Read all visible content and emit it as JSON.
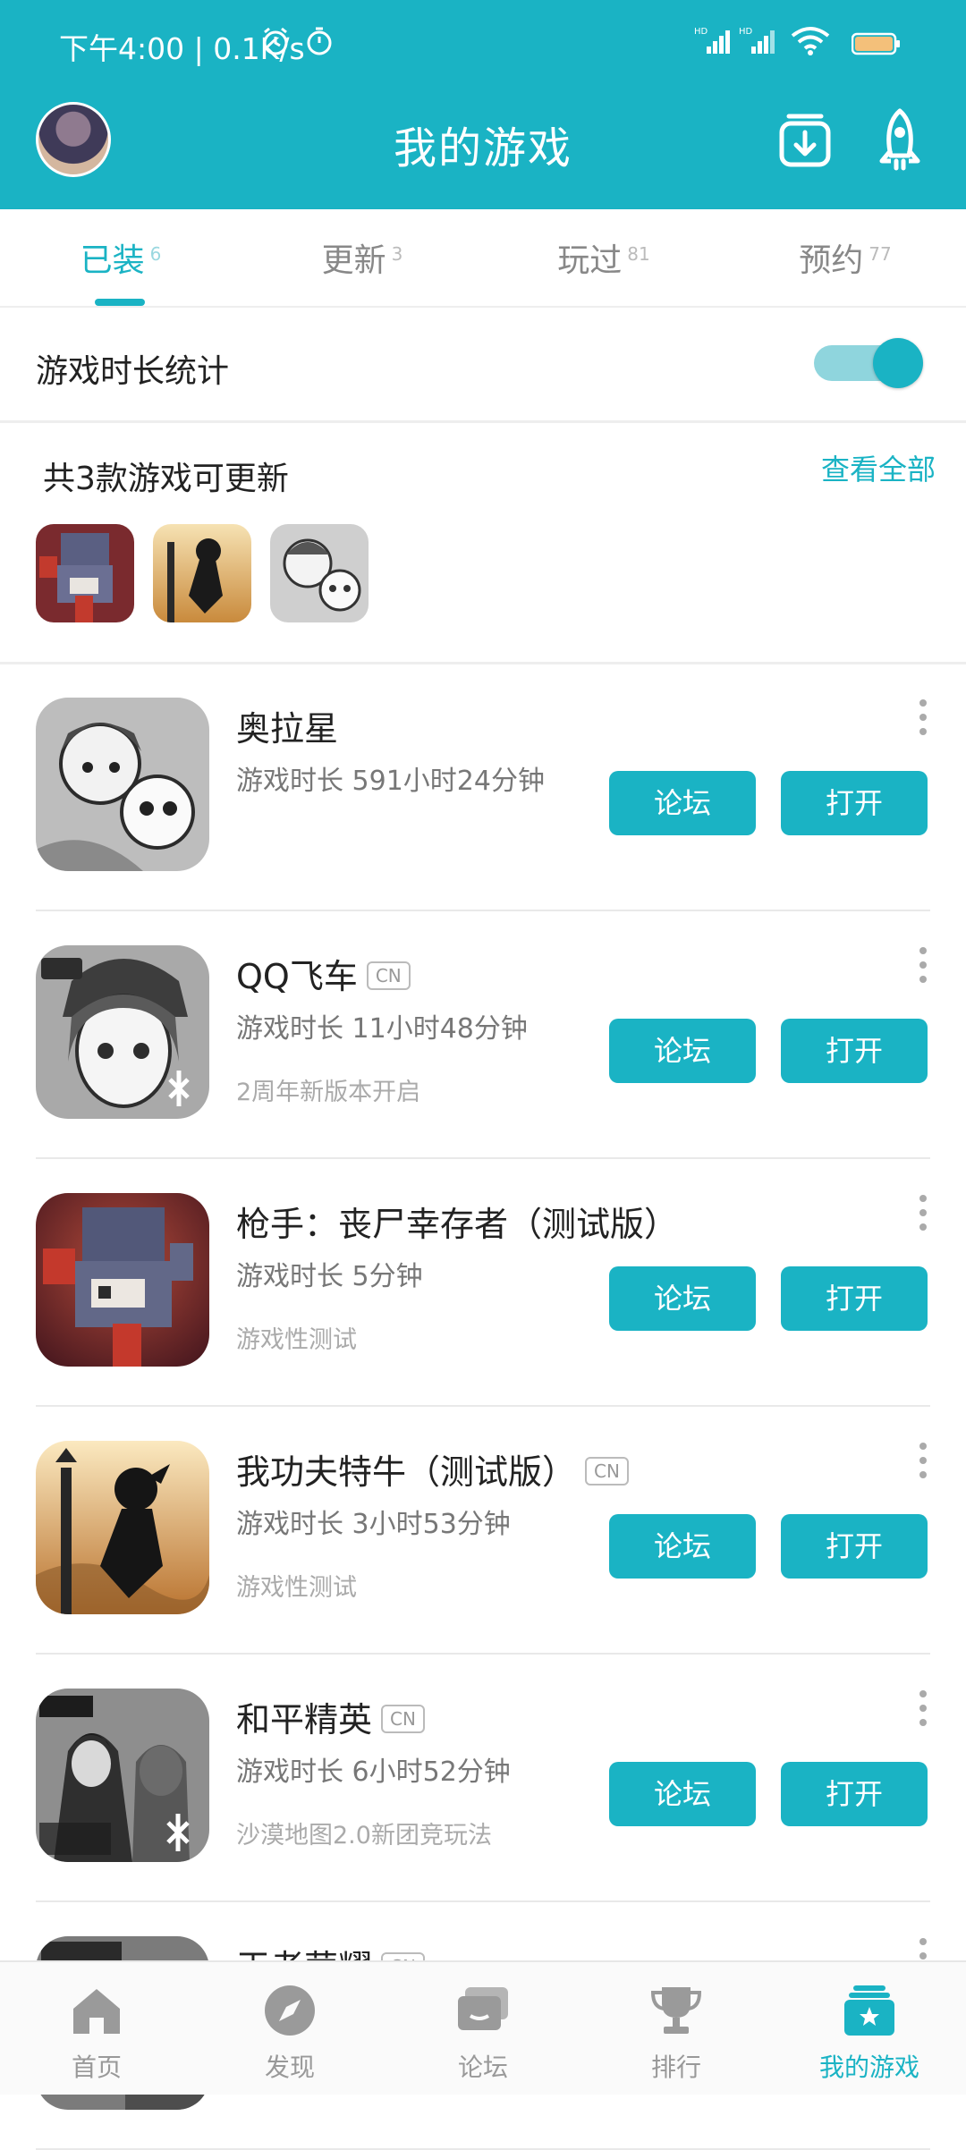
{
  "status_bar": {
    "time": "下午4:00 | 0.1K/s",
    "icons": [
      "alarm-icon",
      "timer-icon",
      "hd-signal-icon",
      "hd-signal-icon",
      "wifi-icon",
      "battery-icon"
    ]
  },
  "header": {
    "title": "我的游戏",
    "icons": [
      "avatar",
      "download-manager-icon",
      "rocket-icon"
    ]
  },
  "tabs": [
    {
      "label": "已装",
      "count": "6"
    },
    {
      "label": "更新",
      "count": "3"
    },
    {
      "label": "玩过",
      "count": "81"
    },
    {
      "label": "预约",
      "count": "77"
    }
  ],
  "active_tab": "已装",
  "stats": {
    "label": "游戏时长统计",
    "toggle_on": true
  },
  "updates": {
    "title": "共3款游戏可更新",
    "link": "查看全部"
  },
  "games": [
    {
      "name": "奥拉星",
      "badge": "",
      "playtime": "游戏时长 591小时24分钟",
      "desc": "",
      "forum": "论坛",
      "open": "打开"
    },
    {
      "name": "QQ飞车",
      "badge": "CN",
      "playtime": "游戏时长 11小时48分钟",
      "desc": "2周年新版本开启",
      "forum": "论坛",
      "open": "打开"
    },
    {
      "name": "枪手：丧尸幸存者（测试版）",
      "badge": "",
      "playtime": "游戏时长 5分钟",
      "desc": "游戏性测试",
      "forum": "论坛",
      "open": "打开"
    },
    {
      "name": "我功夫特牛（测试版）",
      "badge": "CN",
      "playtime": "游戏时长 3小时53分钟",
      "desc": "游戏性测试",
      "forum": "论坛",
      "open": "打开"
    },
    {
      "name": "和平精英",
      "badge": "CN",
      "playtime": "游戏时长 6小时52分钟",
      "desc": "沙漠地图2.0新团竞玩法",
      "forum": "论坛",
      "open": "打开"
    },
    {
      "name": "王者荣耀",
      "badge": "CN",
      "playtime": "",
      "desc": "",
      "forum": "",
      "open": ""
    }
  ],
  "bottom_nav": [
    {
      "label": "首页",
      "icon": "home-icon"
    },
    {
      "label": "发现",
      "icon": "compass-icon"
    },
    {
      "label": "论坛",
      "icon": "chat-icon"
    },
    {
      "label": "排行",
      "icon": "trophy-icon"
    },
    {
      "label": "我的游戏",
      "icon": "my-games-icon"
    }
  ],
  "colors": {
    "accent": "#1ab3c4",
    "accent_light": "#8fd5dd",
    "text": "#222222",
    "muted": "#999999"
  }
}
